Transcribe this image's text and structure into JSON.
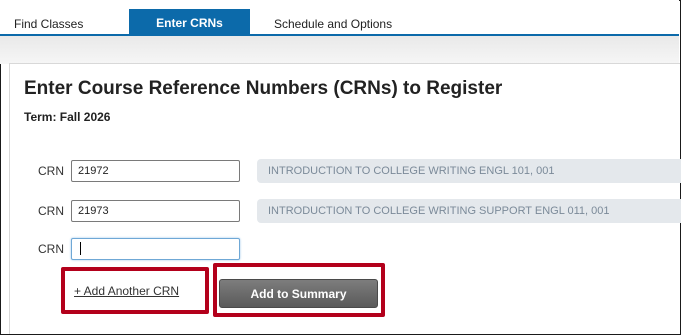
{
  "tabs": [
    {
      "label": "Find Classes",
      "active": false
    },
    {
      "label": "Enter CRNs",
      "active": true
    },
    {
      "label": "Schedule and Options",
      "active": false
    }
  ],
  "page": {
    "title": "Enter Course Reference Numbers (CRNs) to Register",
    "term": "Term: Fall 2026"
  },
  "crn_rows": [
    {
      "label": "CRN",
      "value": "21972",
      "course": "INTRODUCTION TO COLLEGE WRITING ENGL 101, 001"
    },
    {
      "label": "CRN",
      "value": "21973",
      "course": "INTRODUCTION TO COLLEGE WRITING SUPPORT ENGL 011, 001"
    },
    {
      "label": "CRN",
      "value": ""
    }
  ],
  "actions": {
    "add_crn_label": "+ Add Another CRN",
    "add_summary_label": "Add to Summary"
  },
  "colors": {
    "active_tab": "#0c6aaa",
    "highlight_box": "#b3001b",
    "course_chip_bg": "#e4e8ec"
  }
}
